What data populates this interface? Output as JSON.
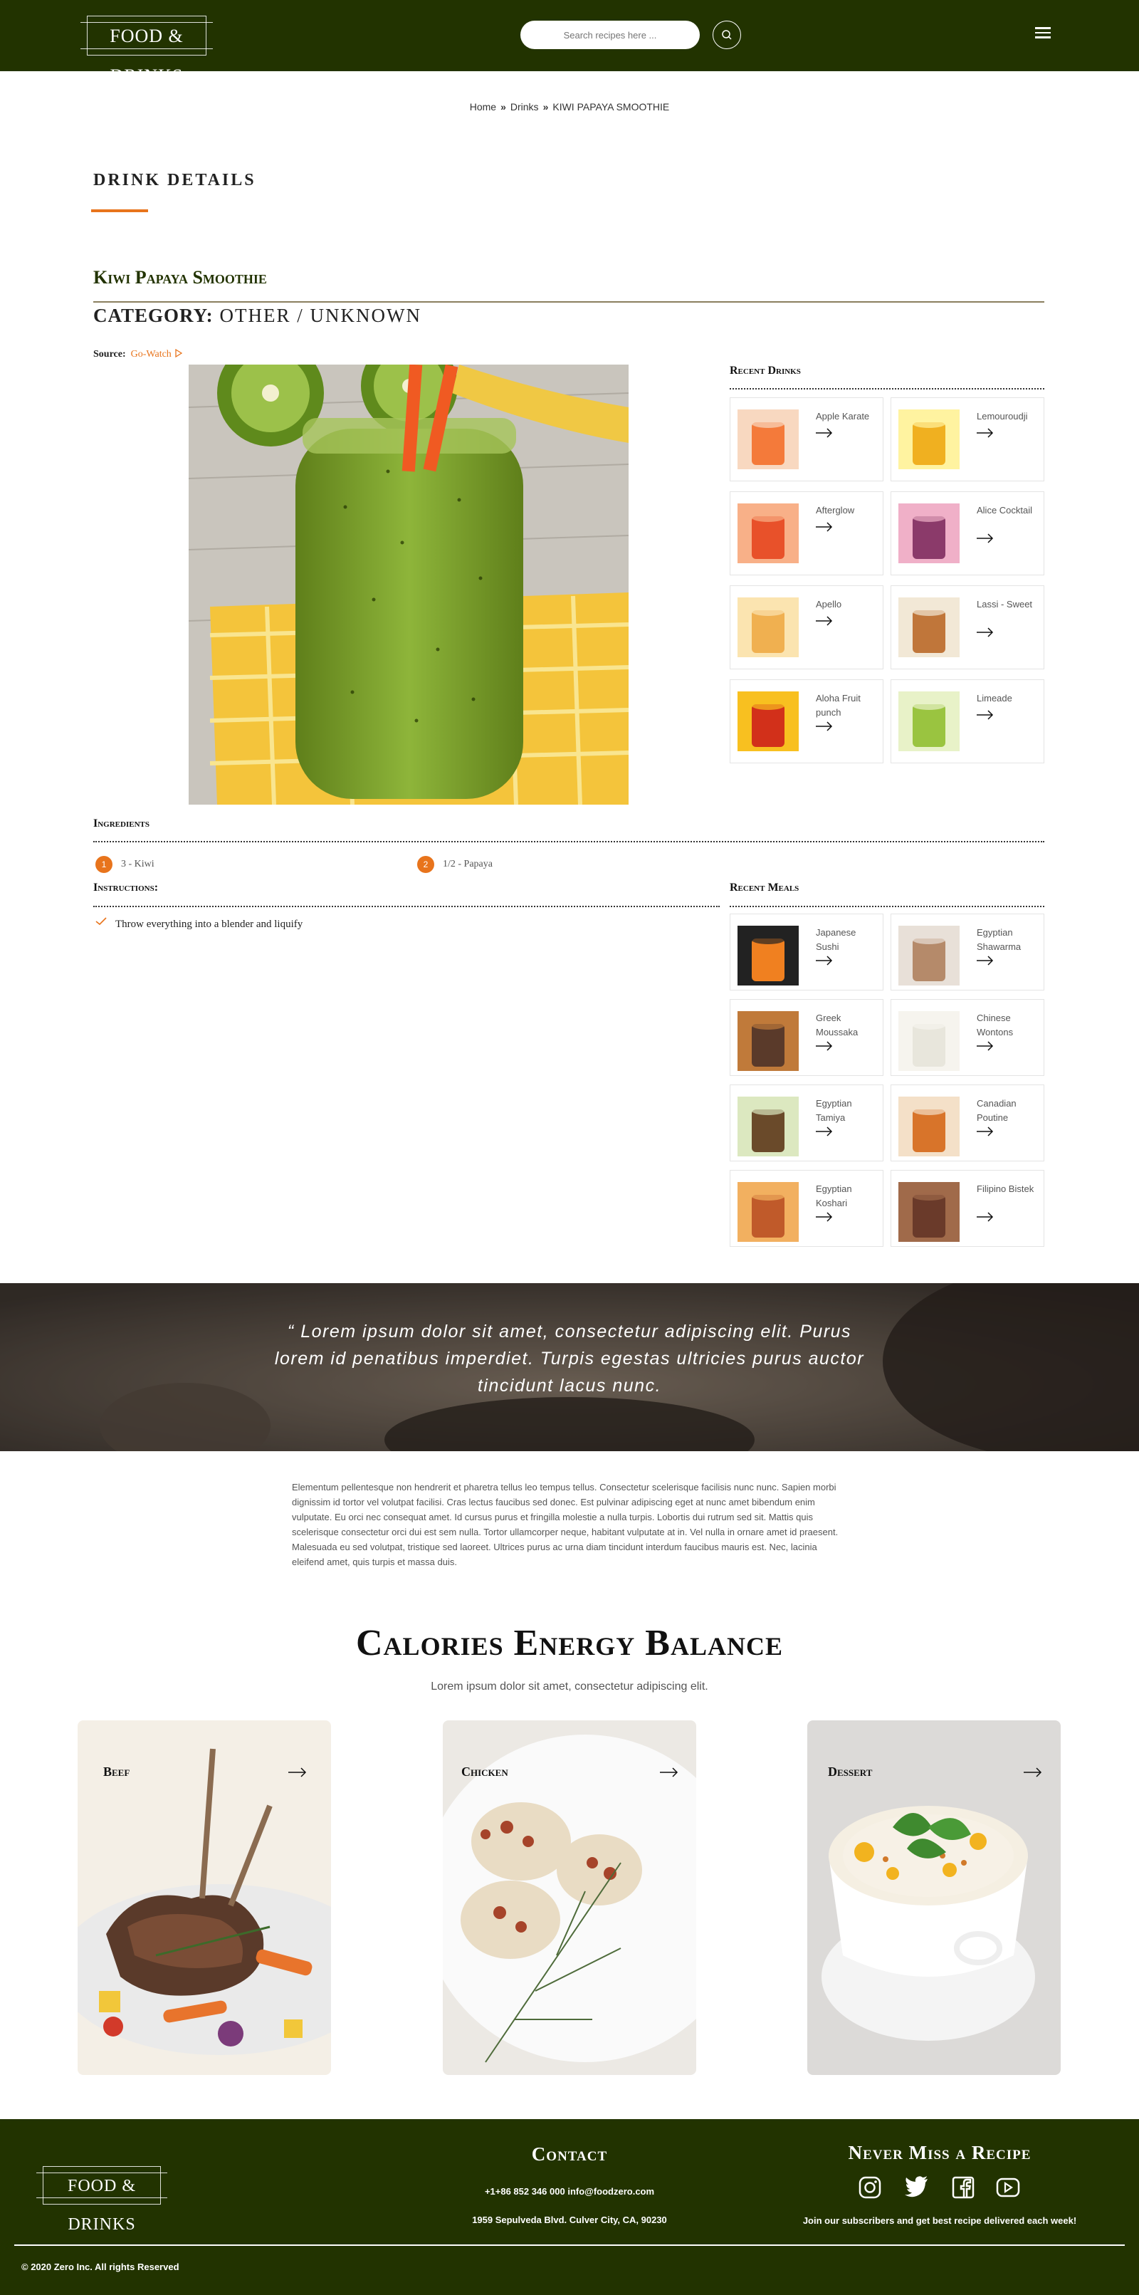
{
  "header": {
    "logo": "FOOD & DRINKS",
    "search_placeholder": "Search recipes here ..."
  },
  "breadcrumb": {
    "home": "Home",
    "drinks": "Drinks",
    "current": "KIWI PAPAYA SMOOTHIE"
  },
  "section_title": "DRINK DETAILS",
  "drink": {
    "title": "Kiwi Papaya Smoothie",
    "category_label": "CATEGORY:",
    "category_value": "OTHER / UNKNOWN",
    "source_label": "Source:",
    "source_link": "Go-Watch"
  },
  "recent_drinks": {
    "title": "Recent Drinks",
    "items": [
      {
        "label": "Apple Karate"
      },
      {
        "label": "Lemouroudji"
      },
      {
        "label": "Afterglow"
      },
      {
        "label": "Alice Cocktail"
      },
      {
        "label": "Apello"
      },
      {
        "label": "Lassi - Sweet"
      },
      {
        "label": "Aloha Fruit punch"
      },
      {
        "label": "Limeade"
      }
    ]
  },
  "ingredients": {
    "title": "Ingredients",
    "items": [
      {
        "num": "1",
        "text": "3 - Kiwi"
      },
      {
        "num": "2",
        "text": "1/2 - Papaya"
      }
    ]
  },
  "instructions": {
    "title": "Instructions:",
    "items": [
      "Throw everything into a blender and liquify"
    ]
  },
  "recent_meals": {
    "title": "Recent Meals",
    "items": [
      {
        "label": "Japanese Sushi"
      },
      {
        "label": "Egyptian Shawarma"
      },
      {
        "label": "Greek Moussaka"
      },
      {
        "label": "Chinese Wontons"
      },
      {
        "label": "Egyptian Tamiya"
      },
      {
        "label": "Canadian Poutine"
      },
      {
        "label": "Egyptian Koshari"
      },
      {
        "label": "Filipino Bistek"
      }
    ]
  },
  "quote": "“ Lorem ipsum dolor sit amet, consectetur adipiscing elit. Purus lorem id penatibus imperdiet. Turpis egestas ultricies purus auctor tincidunt lacus nunc.",
  "paragraph": "Elementum pellentesque non hendrerit et pharetra tellus leo tempus tellus. Consectetur scelerisque facilisis nunc nunc. Sapien morbi dignissim id tortor vel volutpat facilisi. Cras lectus faucibus sed donec. Est pulvinar adipiscing eget at nunc amet bibendum enim vulputate. Eu orci nec consequat amet. Id cursus purus et fringilla molestie a nulla turpis. Lobortis dui rutrum sed sit. Mattis quis scelerisque consectetur orci dui est sem nulla. Tortor ullamcorper neque, habitant vulputate at in. Vel nulla in ornare amet id praesent. Malesuada eu sed volutpat, tristique sed laoreet. Ultrices purus ac urna diam tincidunt interdum faucibus mauris est. Nec, lacinia eleifend amet, quis turpis et massa duis.",
  "calories": {
    "title": "Calories Energy Balance",
    "subtitle": "Lorem ipsum dolor sit amet, consectetur adipiscing elit.",
    "cards": [
      {
        "label": "Beef"
      },
      {
        "label": "Chicken"
      },
      {
        "label": "Dessert"
      }
    ]
  },
  "footer": {
    "logo": "FOOD & DRINKS",
    "contact_title": "Contact",
    "phone_email": "+1+86 852 346 000 info@foodzero.com",
    "address": "1959 Sepulveda Blvd. Culver City, CA, 90230",
    "newsletter_title": "Never Miss a Recipe",
    "newsletter_text": "Join our subscribers and get best recipe delivered each week!",
    "copyright": "© 2020 Zero Inc. All rights Reserved"
  },
  "colors": {
    "header_bg": "#223300",
    "accent": "#e8741c"
  }
}
